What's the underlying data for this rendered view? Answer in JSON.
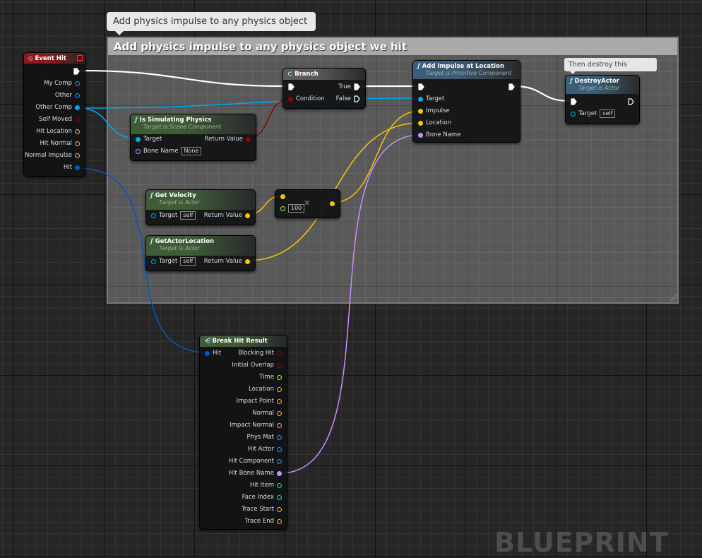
{
  "comment": {
    "bubble": "Add physics impulse to any physics object we hit",
    "title": "Add physics impulse to any physics object we hit"
  },
  "destroy_comment": "Then destroy this projectile",
  "watermark": "BLUEPRINT",
  "pin_colors": {
    "exec": "#ffffff",
    "object": "#00a8f4",
    "struct": "#0057c8",
    "bool": "#950000",
    "vector": "#f8c400",
    "name": "#c98eff",
    "float": "#a0ff3a",
    "int": "#1ee5a8"
  },
  "nodes": [
    {
      "id": "event-hit",
      "kind": "event",
      "title": "Event Hit",
      "header_color": "#8c1a1a",
      "rows": [
        [
          null,
          {
            "type": "exec",
            "connected": true
          }
        ],
        [
          null,
          {
            "label": "My Comp",
            "type": "object"
          }
        ],
        [
          null,
          {
            "label": "Other",
            "type": "object"
          }
        ],
        [
          null,
          {
            "label": "Other Comp",
            "type": "object",
            "connected": true
          }
        ],
        [
          null,
          {
            "label": "Self Moved",
            "type": "bool"
          }
        ],
        [
          null,
          {
            "label": "Hit Location",
            "type": "vector"
          }
        ],
        [
          null,
          {
            "label": "Hit Normal",
            "type": "vector"
          }
        ],
        [
          null,
          {
            "label": "Normal Impulse",
            "type": "vector"
          }
        ],
        [
          null,
          {
            "label": "Hit",
            "type": "struct",
            "connected": true
          }
        ]
      ]
    },
    {
      "id": "is-simulating-physics",
      "kind": "function",
      "title": "Is Simulating Physics",
      "subtitle": "Target is Scene Component",
      "header_color": "#3f5c37",
      "rows": [
        [
          {
            "label": "Target",
            "type": "object",
            "connected": true
          },
          {
            "label": "Return Value",
            "type": "bool",
            "connected": true
          }
        ],
        [
          {
            "label": "Bone Name",
            "type": "name",
            "default": "None"
          },
          null
        ]
      ]
    },
    {
      "id": "branch",
      "kind": "branch",
      "title": "Branch",
      "header_color": "#5b5b5b",
      "rows": [
        [
          {
            "type": "exec",
            "connected": true
          },
          {
            "label": "True",
            "type": "exec",
            "connected": true
          }
        ],
        [
          {
            "label": "Condition",
            "type": "bool",
            "connected": true
          },
          {
            "label": "False",
            "type": "exec"
          }
        ]
      ]
    },
    {
      "id": "add-impulse-at-location",
      "kind": "function",
      "title": "Add Impulse at Location",
      "subtitle": "Target is Primitive Component",
      "header_color": "#3c5d7a",
      "rows": [
        [
          {
            "type": "exec",
            "connected": true
          },
          {
            "type": "exec",
            "connected": true
          }
        ],
        [
          {
            "label": "Target",
            "type": "object",
            "connected": true
          },
          null
        ],
        [
          {
            "label": "Impulse",
            "type": "vector",
            "connected": true
          },
          null
        ],
        [
          {
            "label": "Location",
            "type": "vector",
            "connected": true
          },
          null
        ],
        [
          {
            "label": "Bone Name",
            "type": "name",
            "connected": true
          },
          null
        ]
      ]
    },
    {
      "id": "destroy-actor",
      "kind": "function",
      "title": "DestroyActor",
      "subtitle": "Target is Actor",
      "header_color": "#3c5d7a",
      "rows": [
        [
          {
            "type": "exec",
            "connected": true
          },
          {
            "type": "exec"
          }
        ],
        [
          {
            "label": "Target",
            "type": "object",
            "default": "self"
          },
          null
        ]
      ]
    },
    {
      "id": "get-velocity",
      "kind": "function",
      "title": "Get Velocity",
      "subtitle": "Target is Actor",
      "header_color": "#3f5c37",
      "rows": [
        [
          {
            "label": "Target",
            "type": "object",
            "default": "self"
          },
          {
            "label": "Return Value",
            "type": "vector",
            "connected": true
          }
        ]
      ]
    },
    {
      "id": "get-actor-location",
      "kind": "function",
      "title": "GetActorLocation",
      "subtitle": "Target is Actor",
      "header_color": "#3f5c37",
      "rows": [
        [
          {
            "label": "Target",
            "type": "object",
            "default": "self"
          },
          {
            "label": "Return Value",
            "type": "vector",
            "connected": true
          }
        ]
      ]
    },
    {
      "id": "multiply",
      "kind": "operator",
      "title": "",
      "operator_icon": "multiply-icon",
      "rows": [
        [
          {
            "type": "vector",
            "connected": true
          },
          null
        ],
        [
          {
            "type": "float",
            "default": "100"
          },
          {
            "type": "vector",
            "connected": true
          }
        ]
      ]
    },
    {
      "id": "break-hit-result",
      "kind": "function",
      "title": "Break Hit Result",
      "header_color": "#3f5c37",
      "rows": [
        [
          {
            "label": "Hit",
            "type": "struct",
            "connected": true
          },
          {
            "label": "Blocking Hit",
            "type": "bool"
          }
        ],
        [
          null,
          {
            "label": "Initial Overlap",
            "type": "bool"
          }
        ],
        [
          null,
          {
            "label": "Time",
            "type": "float"
          }
        ],
        [
          null,
          {
            "label": "Location",
            "type": "vector"
          }
        ],
        [
          null,
          {
            "label": "Impact Point",
            "type": "vector"
          }
        ],
        [
          null,
          {
            "label": "Normal",
            "type": "vector"
          }
        ],
        [
          null,
          {
            "label": "Impact Normal",
            "type": "vector"
          }
        ],
        [
          null,
          {
            "label": "Phys Mat",
            "type": "object"
          }
        ],
        [
          null,
          {
            "label": "Hit Actor",
            "type": "object"
          }
        ],
        [
          null,
          {
            "label": "Hit Component",
            "type": "object"
          }
        ],
        [
          null,
          {
            "label": "Hit Bone Name",
            "type": "name",
            "connected": true
          }
        ],
        [
          null,
          {
            "label": "Hit Item",
            "type": "int"
          }
        ],
        [
          null,
          {
            "label": "Face Index",
            "type": "int"
          }
        ],
        [
          null,
          {
            "label": "Trace Start",
            "type": "vector"
          }
        ],
        [
          null,
          {
            "label": "Trace End",
            "type": "vector"
          }
        ]
      ]
    }
  ]
}
